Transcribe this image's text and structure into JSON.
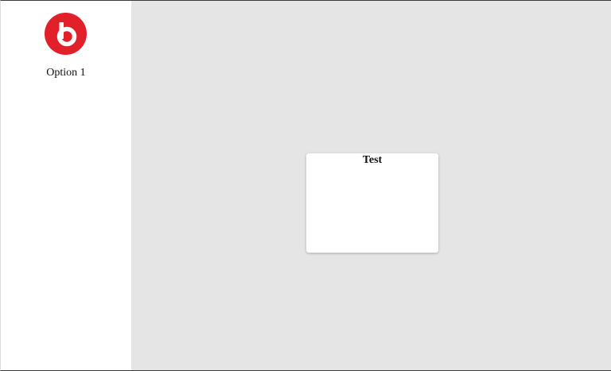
{
  "sidebar": {
    "logo_icon": "beats-logo-icon",
    "brand_color": "#e2202a",
    "items": [
      {
        "label": "Option 1"
      }
    ]
  },
  "main": {
    "background": "#e5e5e5",
    "card": {
      "title": "Test"
    }
  }
}
